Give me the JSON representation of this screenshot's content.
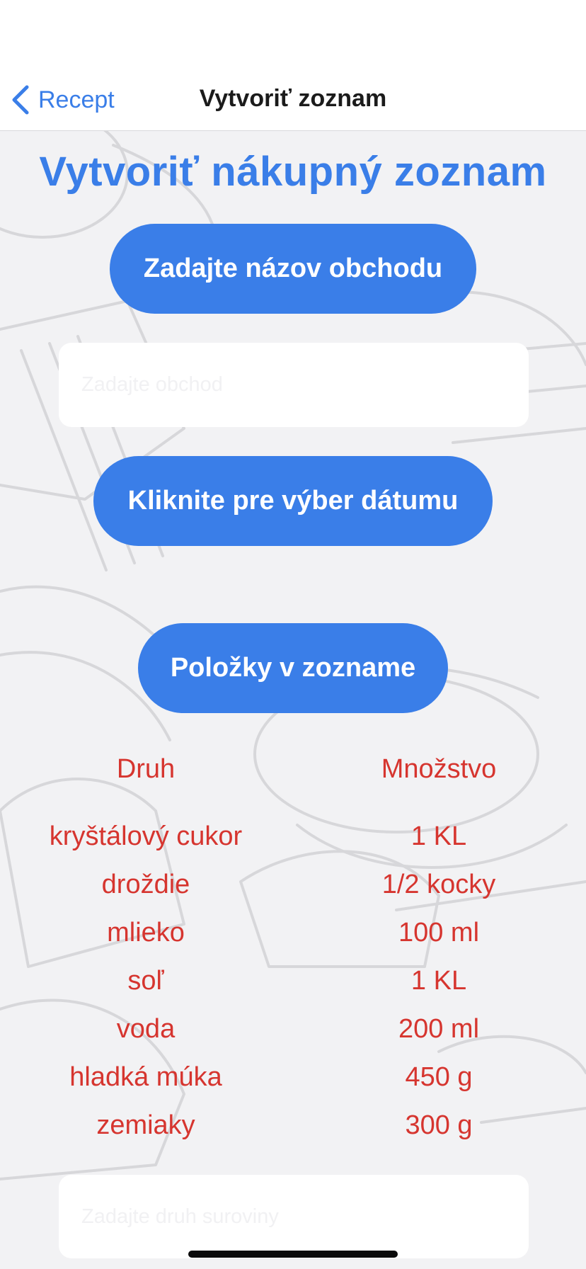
{
  "nav": {
    "back_label": "Recept",
    "title": "Vytvoriť zoznam"
  },
  "page": {
    "title": "Vytvoriť nákupný zoznam"
  },
  "buttons": {
    "store_name": "Zadajte názov obchodu",
    "pick_date": "Kliknite pre výber dátumu",
    "list_items": "Položky v zozname"
  },
  "fields": {
    "store_placeholder": "Zadajte obchod",
    "store_value": "",
    "ingredient_placeholder": "Zadajte druh suroviny",
    "ingredient_value": ""
  },
  "table": {
    "headers": [
      "Druh",
      "Množstvo"
    ],
    "rows": [
      [
        "kryštálový cukor",
        "1 KL"
      ],
      [
        "droždie",
        "1/2 kocky"
      ],
      [
        "mlieko",
        "100 ml"
      ],
      [
        "soľ",
        "1 KL"
      ],
      [
        "voda",
        "200 ml"
      ],
      [
        "hladká múka",
        "450 g"
      ],
      [
        "zemiaky",
        "300 g"
      ]
    ]
  },
  "icons": {
    "back": "chevron-left-icon"
  },
  "colors": {
    "accent": "#3a7ee8",
    "table_text": "#d6352f",
    "background": "#f2f2f4"
  }
}
